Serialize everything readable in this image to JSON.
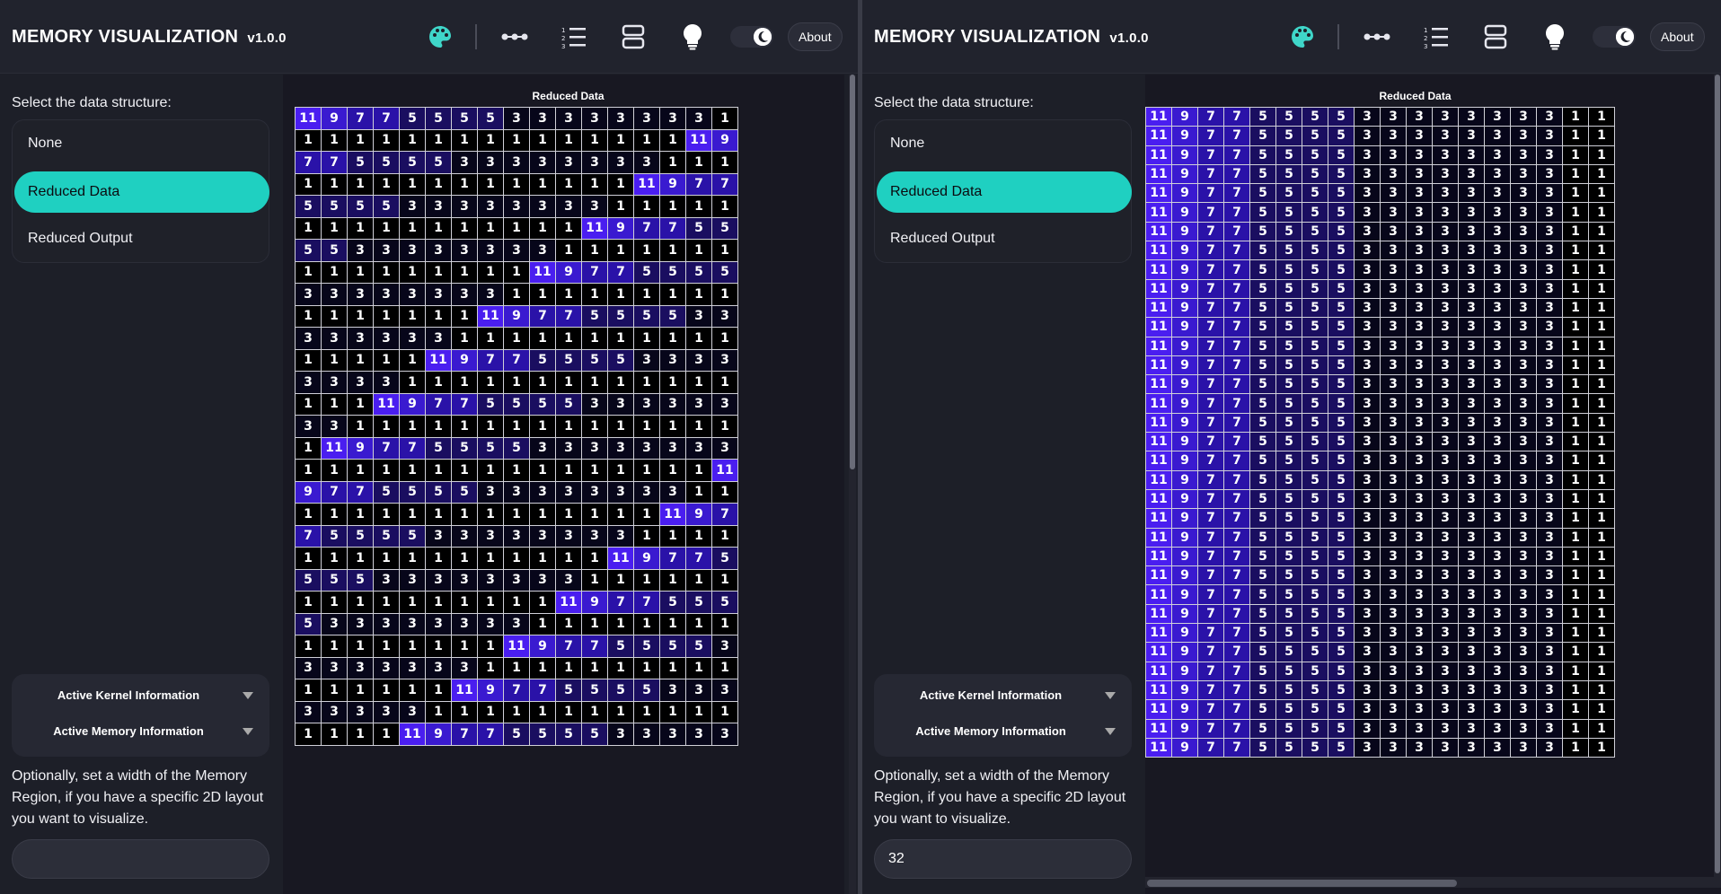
{
  "app": {
    "title": "MEMORY VISUALIZATION",
    "version": "v1.0.0",
    "about_label": "About",
    "header_icons": [
      "palette-icon",
      "three-dots-icon",
      "numbered-list-icon",
      "layout-rows-icon",
      "lightbulb-icon",
      "theme-toggle-moon-icon"
    ]
  },
  "colors": {
    "accent": "#1fd0c1",
    "cell_background": "#000000",
    "cell_ramp": {
      "1": "#000000",
      "3": "#07061a",
      "5": "#1a0e60",
      "7": "#2a12a8",
      "9": "#3a1ad0",
      "11": "#4a1ef0"
    }
  },
  "sidebar": {
    "select_label": "Select the data structure:",
    "items": [
      {
        "label": "None",
        "active": false
      },
      {
        "label": "Reduced Data",
        "active": true
      },
      {
        "label": "Reduced Output",
        "active": false
      }
    ],
    "active_kernel_label": "Active Kernel Information",
    "active_memory_label": "Active Memory Information",
    "width_help": "Optionally, set a width of the Memory Region, if you have a specific 2D layout you want to visualize."
  },
  "panes": {
    "left": {
      "width_value": "",
      "grid_title": "Reduced Data"
    },
    "right": {
      "width_value": "32",
      "grid_title": "Reduced Data"
    }
  },
  "grids": {
    "left": {
      "columns": 17,
      "rows": [
        [
          11,
          9,
          7,
          7,
          5,
          5,
          5,
          5,
          3,
          3,
          3,
          3,
          3,
          3,
          3,
          3,
          1
        ],
        [
          1,
          1,
          1,
          1,
          1,
          1,
          1,
          1,
          1,
          1,
          1,
          1,
          1,
          1,
          1,
          11,
          9
        ],
        [
          7,
          7,
          5,
          5,
          5,
          5,
          3,
          3,
          3,
          3,
          3,
          3,
          3,
          3,
          1,
          1,
          1
        ],
        [
          1,
          1,
          1,
          1,
          1,
          1,
          1,
          1,
          1,
          1,
          1,
          1,
          1,
          11,
          9,
          7,
          7
        ],
        [
          5,
          5,
          5,
          5,
          3,
          3,
          3,
          3,
          3,
          3,
          3,
          3,
          1,
          1,
          1,
          1,
          1
        ],
        [
          1,
          1,
          1,
          1,
          1,
          1,
          1,
          1,
          1,
          1,
          1,
          11,
          9,
          7,
          7,
          5,
          5
        ],
        [
          5,
          5,
          3,
          3,
          3,
          3,
          3,
          3,
          3,
          3,
          1,
          1,
          1,
          1,
          1,
          1,
          1
        ],
        [
          1,
          1,
          1,
          1,
          1,
          1,
          1,
          1,
          1,
          11,
          9,
          7,
          7,
          5,
          5,
          5,
          5
        ],
        [
          3,
          3,
          3,
          3,
          3,
          3,
          3,
          3,
          1,
          1,
          1,
          1,
          1,
          1,
          1,
          1,
          1
        ],
        [
          1,
          1,
          1,
          1,
          1,
          1,
          1,
          11,
          9,
          7,
          7,
          5,
          5,
          5,
          5,
          3,
          3
        ],
        [
          3,
          3,
          3,
          3,
          3,
          3,
          1,
          1,
          1,
          1,
          1,
          1,
          1,
          1,
          1,
          1,
          1
        ],
        [
          1,
          1,
          1,
          1,
          1,
          11,
          9,
          7,
          7,
          5,
          5,
          5,
          5,
          3,
          3,
          3,
          3
        ],
        [
          3,
          3,
          3,
          3,
          1,
          1,
          1,
          1,
          1,
          1,
          1,
          1,
          1,
          1,
          1,
          1,
          1
        ],
        [
          1,
          1,
          1,
          11,
          9,
          7,
          7,
          5,
          5,
          5,
          5,
          3,
          3,
          3,
          3,
          3,
          3
        ],
        [
          3,
          3,
          1,
          1,
          1,
          1,
          1,
          1,
          1,
          1,
          1,
          1,
          1,
          1,
          1,
          1,
          1
        ],
        [
          1,
          11,
          9,
          7,
          7,
          5,
          5,
          5,
          5,
          3,
          3,
          3,
          3,
          3,
          3,
          3,
          3
        ],
        [
          1,
          1,
          1,
          1,
          1,
          1,
          1,
          1,
          1,
          1,
          1,
          1,
          1,
          1,
          1,
          1,
          11
        ],
        [
          9,
          7,
          7,
          5,
          5,
          5,
          5,
          3,
          3,
          3,
          3,
          3,
          3,
          3,
          3,
          1,
          1
        ],
        [
          1,
          1,
          1,
          1,
          1,
          1,
          1,
          1,
          1,
          1,
          1,
          1,
          1,
          1,
          11,
          9,
          7
        ],
        [
          7,
          5,
          5,
          5,
          5,
          3,
          3,
          3,
          3,
          3,
          3,
          3,
          3,
          1,
          1,
          1,
          1
        ],
        [
          1,
          1,
          1,
          1,
          1,
          1,
          1,
          1,
          1,
          1,
          1,
          1,
          11,
          9,
          7,
          7,
          5
        ],
        [
          5,
          5,
          5,
          3,
          3,
          3,
          3,
          3,
          3,
          3,
          3,
          1,
          1,
          1,
          1,
          1,
          1
        ],
        [
          1,
          1,
          1,
          1,
          1,
          1,
          1,
          1,
          1,
          1,
          11,
          9,
          7,
          7,
          5,
          5,
          5
        ],
        [
          5,
          3,
          3,
          3,
          3,
          3,
          3,
          3,
          3,
          1,
          1,
          1,
          1,
          1,
          1,
          1,
          1
        ],
        [
          1,
          1,
          1,
          1,
          1,
          1,
          1,
          1,
          11,
          9,
          7,
          7,
          5,
          5,
          5,
          5,
          3
        ],
        [
          3,
          3,
          3,
          3,
          3,
          3,
          3,
          1,
          1,
          1,
          1,
          1,
          1,
          1,
          1,
          1,
          1
        ],
        [
          1,
          1,
          1,
          1,
          1,
          1,
          11,
          9,
          7,
          7,
          5,
          5,
          5,
          5,
          3,
          3,
          3
        ],
        [
          3,
          3,
          3,
          3,
          3,
          1,
          1,
          1,
          1,
          1,
          1,
          1,
          1,
          1,
          1,
          1,
          1
        ],
        [
          1,
          1,
          1,
          1,
          11,
          9,
          7,
          7,
          5,
          5,
          5,
          5,
          3,
          3,
          3,
          3,
          3
        ]
      ]
    },
    "right": {
      "columns": 18,
      "row_pattern": [
        11,
        9,
        7,
        7,
        5,
        5,
        5,
        5,
        3,
        3,
        3,
        3,
        3,
        3,
        3,
        3,
        1,
        1
      ],
      "row_count": 34
    }
  }
}
